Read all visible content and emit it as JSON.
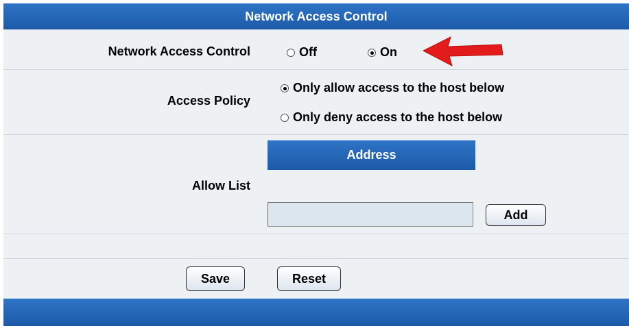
{
  "header": {
    "title": "Network Access Control"
  },
  "nac_row": {
    "label": "Network Access Control",
    "options": [
      {
        "label": "Off",
        "checked": false
      },
      {
        "label": "On",
        "checked": true
      }
    ]
  },
  "policy_row": {
    "label": "Access Policy",
    "options": [
      {
        "label": "Only allow access to the host below",
        "checked": true
      },
      {
        "label": "Only deny access to the host below",
        "checked": false
      }
    ]
  },
  "allow_list": {
    "label": "Allow List",
    "column_header": "Address",
    "input_value": "",
    "add_label": "Add"
  },
  "footer": {
    "save_label": "Save",
    "reset_label": "Reset"
  },
  "annotation": {
    "arrow_color": "#e31b1b",
    "arrow_icon": "red-arrow-icon"
  },
  "colors": {
    "header_blue": "#1f5fae",
    "panel_bg": "#eef1f3"
  }
}
